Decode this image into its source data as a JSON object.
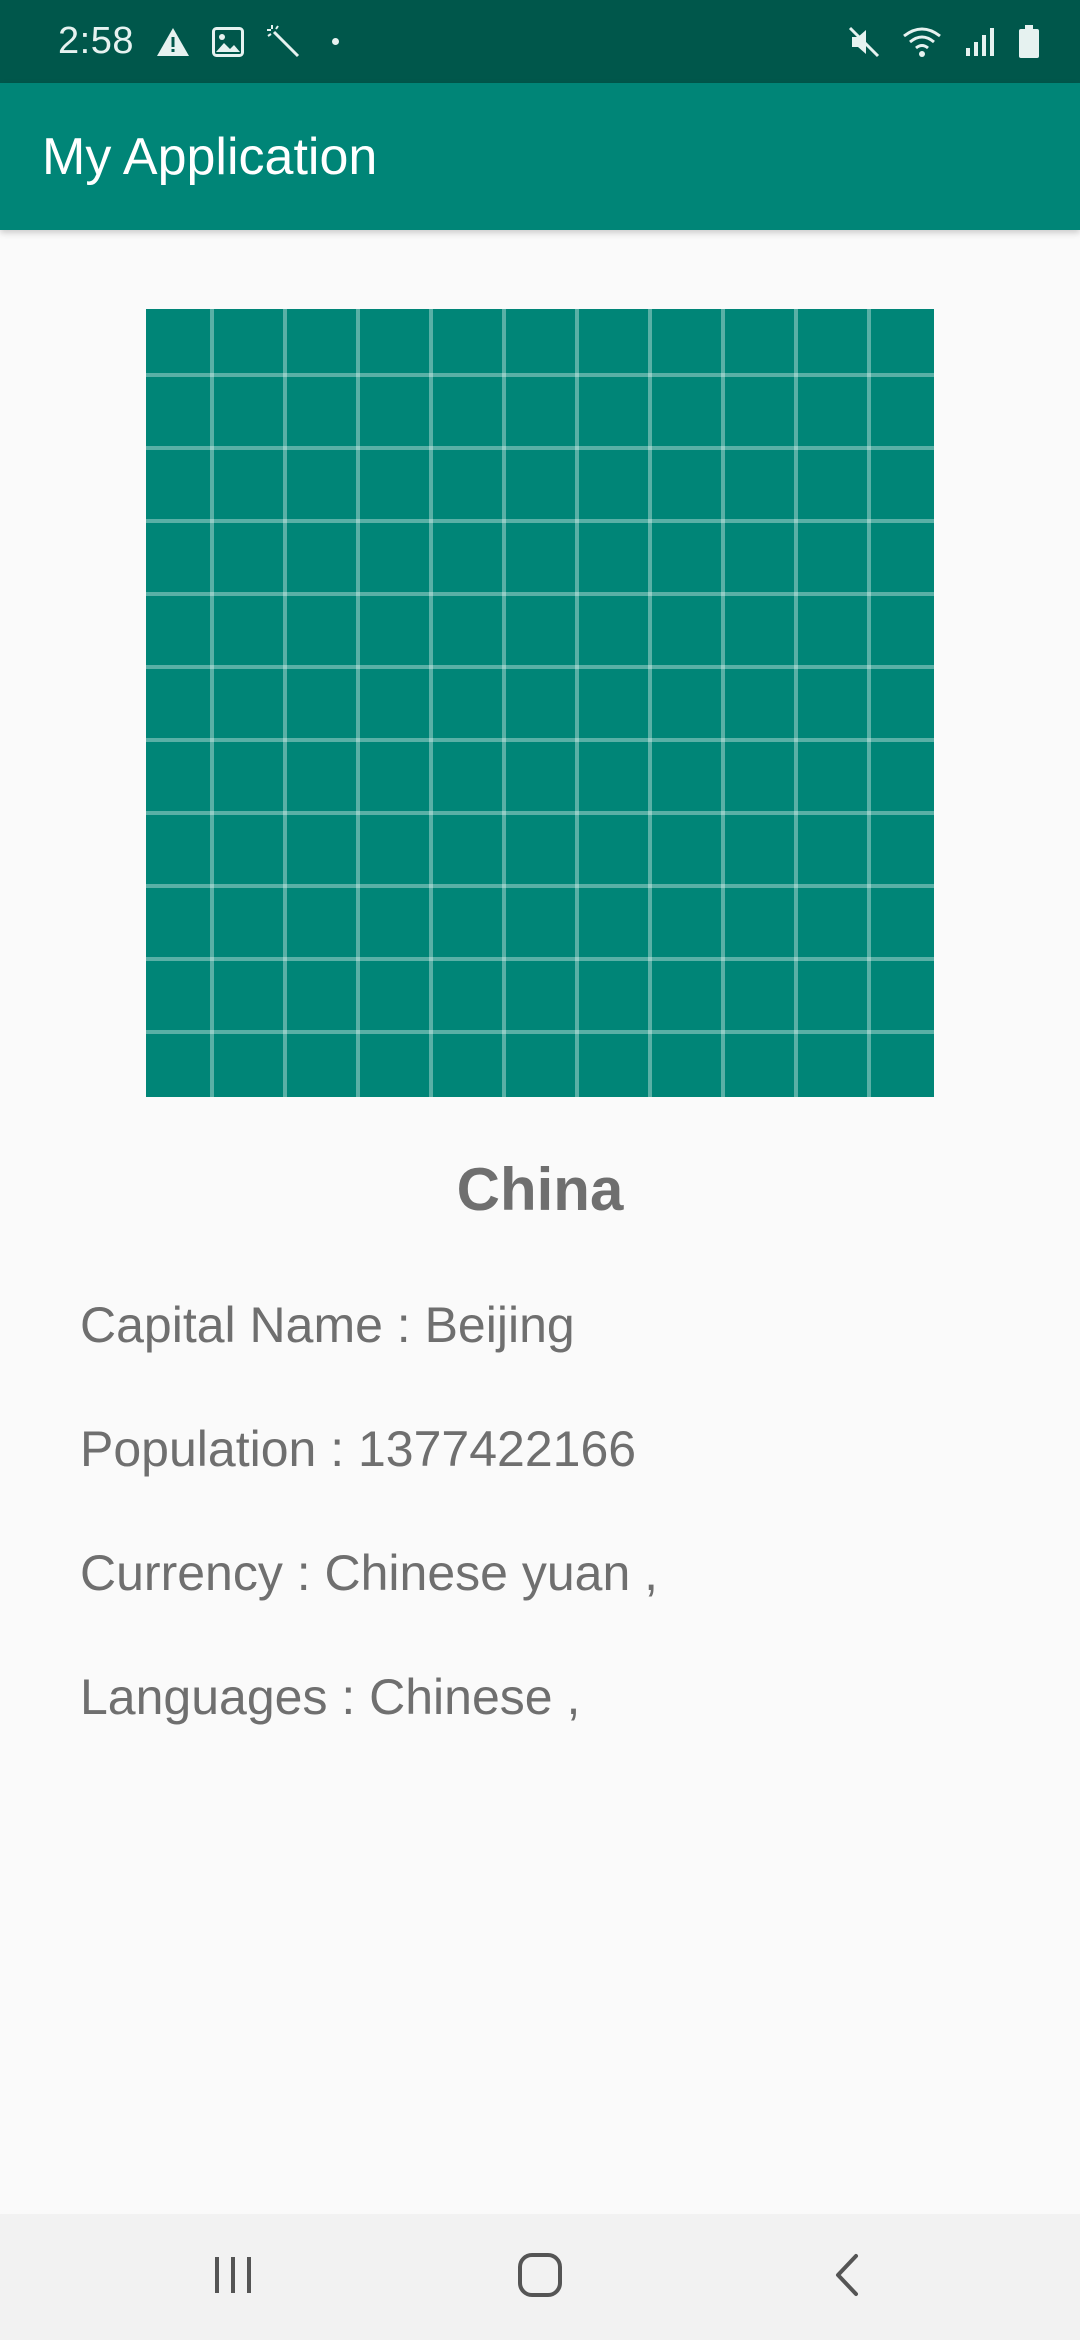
{
  "status_bar": {
    "time": "2:58",
    "icons_left": [
      "warning-icon",
      "image-icon",
      "magic-wand-icon",
      "dot-icon"
    ],
    "icons_right": [
      "mute-icon",
      "wifi-icon",
      "signal-icon",
      "battery-icon"
    ]
  },
  "app_bar": {
    "title": "My Application"
  },
  "flag": {
    "icon": "grid-flag-placeholder",
    "color": "#008577"
  },
  "country": {
    "name": "China",
    "capital_line": "Capital Name : Beijing",
    "population_line": "Population : 1377422166",
    "currency_line": "Currency : Chinese yuan ,",
    "languages_line": "Languages : Chinese ,"
  },
  "nav_bar": {
    "buttons": [
      "recents-icon",
      "home-icon",
      "back-icon"
    ]
  },
  "colors": {
    "status_bar": "#00574b",
    "app_bar": "#008577",
    "text": "#6f6f6f",
    "background": "#fafafa"
  }
}
